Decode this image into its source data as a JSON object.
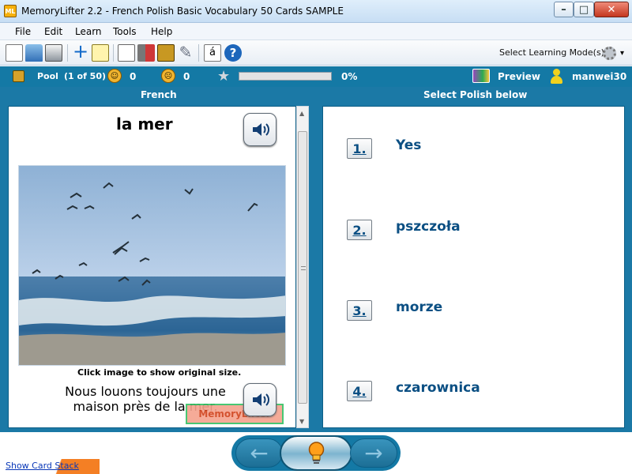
{
  "window": {
    "title": "MemoryLifter 2.2 - French Polish Basic Vocabulary 50 Cards SAMPLE",
    "icon_text": "ML",
    "controls": {
      "minimize": "–",
      "maximize": "□",
      "close": "✕"
    }
  },
  "menu": {
    "items": [
      "File",
      "Edit",
      "Learn",
      "Tools",
      "Help"
    ]
  },
  "toolbar": {
    "select_mode_label": "Select Learning Mode(s)",
    "mode_dropdown_arrow": "▾",
    "special_char_label": "á",
    "help_label": "?"
  },
  "status": {
    "pool_label": "Pool",
    "pool_count": "(1 of 50)",
    "correct_count": "0",
    "wrong_count": "0",
    "progress_percent_text": "0%",
    "progress_fraction": 0,
    "preview_label": "Preview",
    "username": "manwei30"
  },
  "panes": {
    "left_title": "French",
    "right_title": "Select Polish below"
  },
  "card": {
    "word": "la mer",
    "image_caption": "Click image to show original size.",
    "example_sentence": "Nous louons toujours une maison près de la mer.",
    "watermark_text": "MemoryLifter"
  },
  "choices": [
    {
      "number": "1.",
      "text": "Yes"
    },
    {
      "number": "2.",
      "text": "pszczoła"
    },
    {
      "number": "3.",
      "text": "morze"
    },
    {
      "number": "4.",
      "text": "czarownica"
    }
  ],
  "bottom": {
    "show_card_stack": "Show Card Stack",
    "prev_arrow": "←",
    "next_arrow": "→"
  },
  "colors": {
    "brand_blue": "#1479a5",
    "choice_text": "#0b4f83",
    "card_stack_accent": "#f47f24"
  },
  "icons": {
    "window": "memorylifter-app-icon",
    "toolbar": [
      "new-document-icon",
      "open-folder-icon",
      "print-icon",
      "add-card-icon",
      "edit-card-icon",
      "presentation-icon",
      "statistics-icon",
      "card-box-icon",
      "tools-icon",
      "special-character-icon",
      "help-icon",
      "learning-mode-gear-icon"
    ],
    "status": [
      "pool-icon",
      "correct-face-icon",
      "wrong-face-icon",
      "progress-star-icon",
      "preview-icon",
      "user-icon"
    ]
  }
}
